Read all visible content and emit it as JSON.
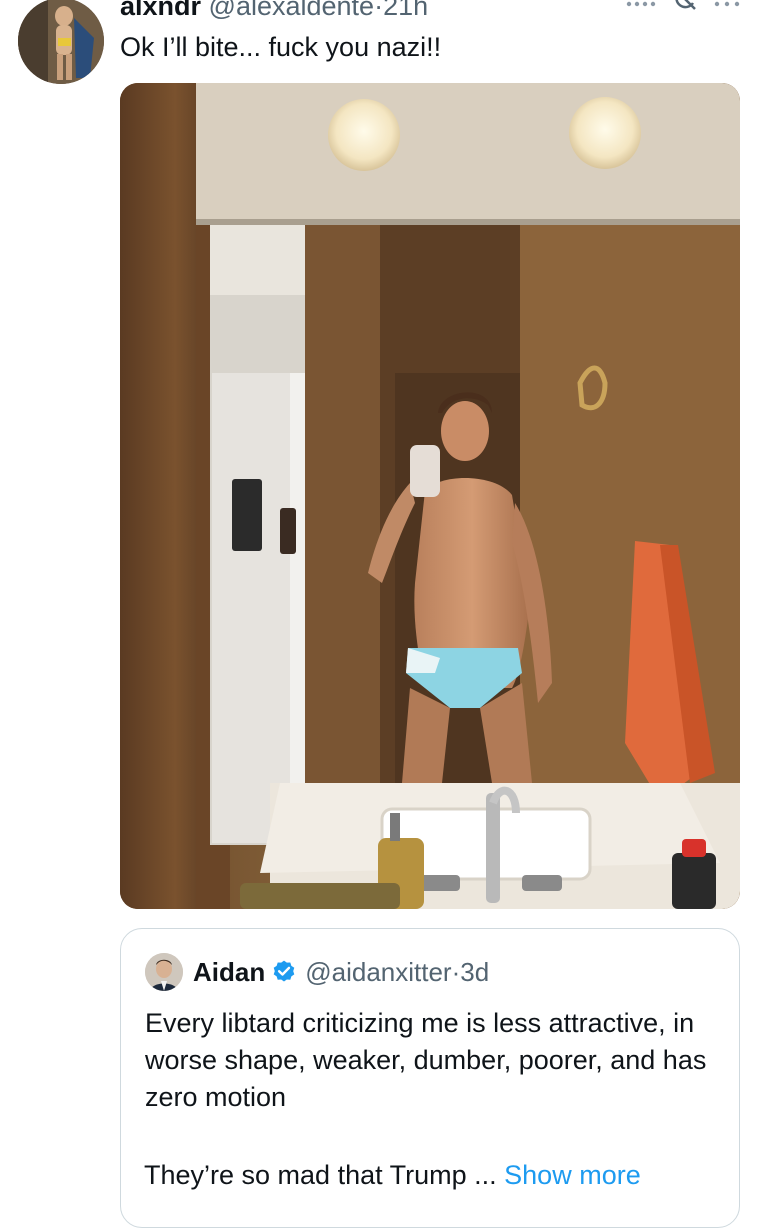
{
  "post": {
    "display_name": "alxndr",
    "handle": "@alexaldente",
    "separator": "·",
    "time": "21h",
    "text": "Ok I’ll bite... fuck you nazi!!"
  },
  "quoted_post": {
    "display_name": "Aidan",
    "verified": true,
    "handle": "@aidanxitter",
    "separator": "·",
    "time": "3d",
    "text": "Every libtard criticizing me is less attractive, in worse shape, weaker, dumber, poorer, and has zero motion",
    "text_truncated": "They’re so mad that Trump ...",
    "show_more_label": "Show more"
  },
  "icons": {
    "top_actions": [
      "more-dots-icon",
      "grok-icon",
      "more-icon"
    ]
  },
  "colors": {
    "handle_gray": "#536471",
    "link_blue": "#1d9bf0",
    "border": "#cfd9de",
    "verified_blue": "#1d9bf0"
  }
}
